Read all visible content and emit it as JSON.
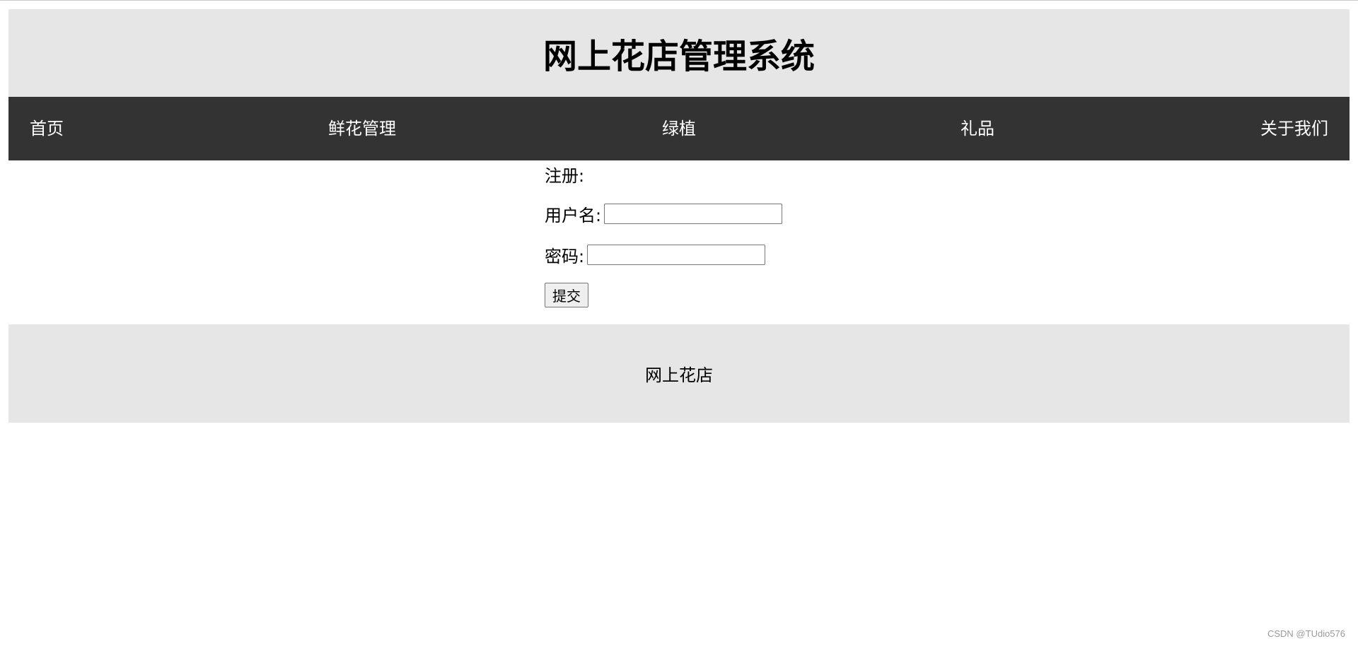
{
  "header": {
    "title": "网上花店管理系统"
  },
  "nav": {
    "items": [
      {
        "label": "首页"
      },
      {
        "label": "鲜花管理"
      },
      {
        "label": "绿植"
      },
      {
        "label": "礼品"
      },
      {
        "label": "关于我们"
      }
    ]
  },
  "form": {
    "title": "注册:",
    "username_label": "用户名:",
    "username_value": "",
    "password_label": "密码:",
    "password_value": "",
    "submit_label": "提交"
  },
  "footer": {
    "text": "网上花店"
  },
  "watermark": {
    "text": "CSDN @TUdio576"
  },
  "colors": {
    "header_bg": "#e6e6e6",
    "nav_bg": "#333333",
    "nav_text": "#ffffff",
    "footer_bg": "#e6e6e6"
  }
}
